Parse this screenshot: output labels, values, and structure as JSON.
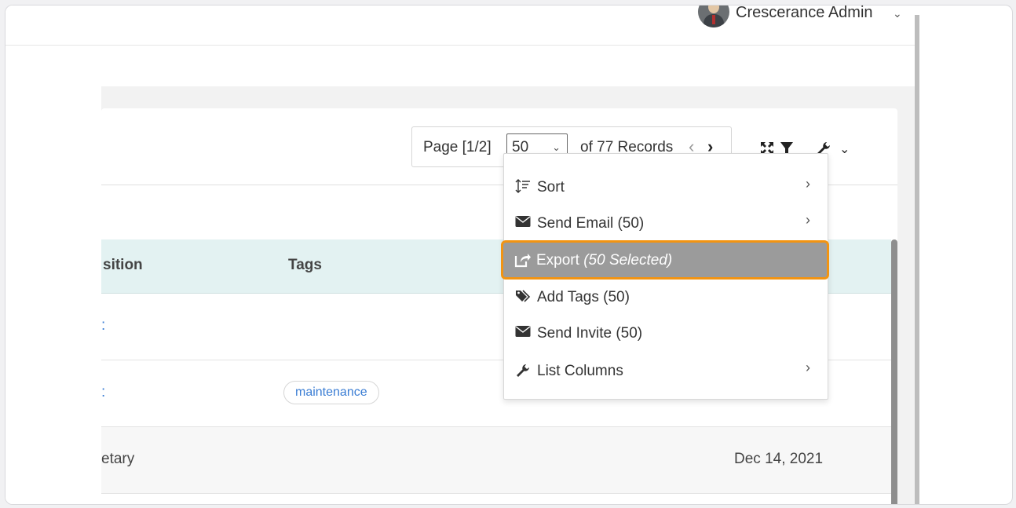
{
  "header": {
    "user_name": "Crescerance Admin"
  },
  "pager": {
    "page_label": "Page [1/2]",
    "page_size": "50",
    "records_label": "of 77 Records"
  },
  "table": {
    "columns": [
      "sition",
      "Tags"
    ],
    "rows": [
      {
        "left_fragment": ":",
        "tag": "",
        "date": ""
      },
      {
        "left_fragment": ":",
        "tag": "maintenance",
        "date": ""
      },
      {
        "left_fragment": "etary",
        "tag": "",
        "date": "Dec 14, 2021"
      }
    ]
  },
  "menu": {
    "items": [
      {
        "label": "Sort",
        "icon": "sort-icon",
        "has_submenu": true
      },
      {
        "label": "Send Email (50)",
        "icon": "envelope-icon",
        "has_submenu": true
      },
      {
        "label": "Export",
        "label_extra": "(50 Selected)",
        "icon": "export-icon",
        "has_submenu": false,
        "highlighted": true
      },
      {
        "label": "Add Tags (50)",
        "icon": "tags-icon",
        "has_submenu": false
      },
      {
        "label": "Send Invite (50)",
        "icon": "envelope-icon",
        "has_submenu": false
      },
      {
        "label": "List Columns",
        "icon": "wrench-icon",
        "has_submenu": true
      }
    ]
  },
  "colors": {
    "highlight_border": "#f29412",
    "highlight_bg": "#9b9b9b",
    "table_header_bg": "#e3f2f2",
    "link": "#3a7dd4"
  }
}
